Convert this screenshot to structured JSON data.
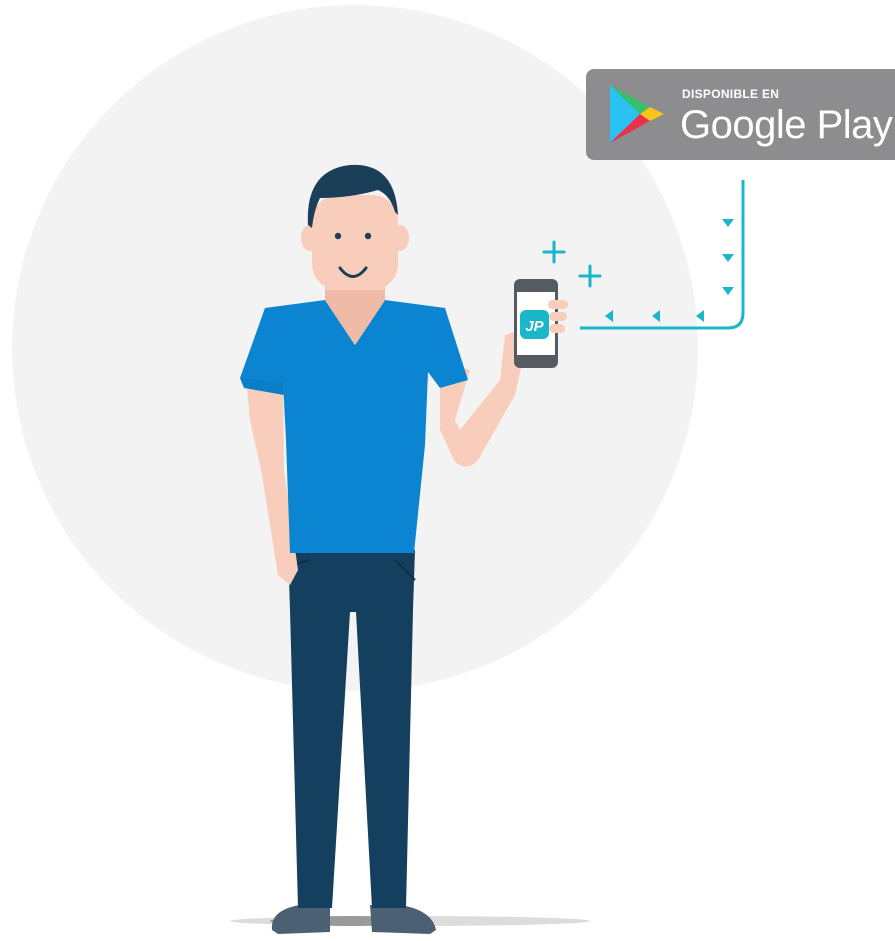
{
  "store_badge": {
    "small_text": "DISPONIBLE EN",
    "store_name": "Google Play"
  },
  "app_icon": {
    "label": "JP"
  },
  "icons": [
    "google-play-icon",
    "plus-icon",
    "arrow-icon",
    "phone-icon",
    "person-illustration"
  ],
  "colors": {
    "background_circle": "#f3f3f3",
    "badge": "#8d8d8f",
    "shirt": "#0b85d1",
    "pants": "#143f5e",
    "skin": "#f9cdbb",
    "hair": "#1b3f58",
    "accent": "#1ab6c9"
  }
}
